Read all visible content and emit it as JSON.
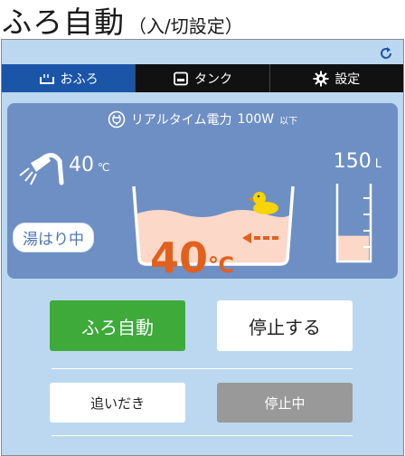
{
  "header": {
    "title": "ふろ自動",
    "subtitle": "（入/切設定）"
  },
  "tabs": [
    {
      "label": "おふろ",
      "icon": "bath-icon",
      "active": true
    },
    {
      "label": "タンク",
      "icon": "tank-icon",
      "active": false
    },
    {
      "label": "設定",
      "icon": "gear-icon",
      "active": false
    }
  ],
  "power": {
    "label": "リアルタイム電力",
    "value": "100W",
    "suffix": "以下"
  },
  "status": {
    "shower_temp": "40",
    "shower_temp_unit": "℃",
    "volume": "150",
    "volume_unit": "L",
    "state_badge": "湯はり中",
    "bath_temp": "40",
    "bath_temp_unit": "℃",
    "tank_level": 0.33
  },
  "buttons": {
    "auto": "ふろ自動",
    "stop": "停止する",
    "oidaki": "追いだき",
    "stopping": "停止中"
  },
  "colors": {
    "panel_bg": "#bcd8f0",
    "tab_active": "#1b55a8",
    "info_bg": "#6e8fc4",
    "accent_orange": "#e2601e",
    "start_green": "#3daa3a"
  }
}
